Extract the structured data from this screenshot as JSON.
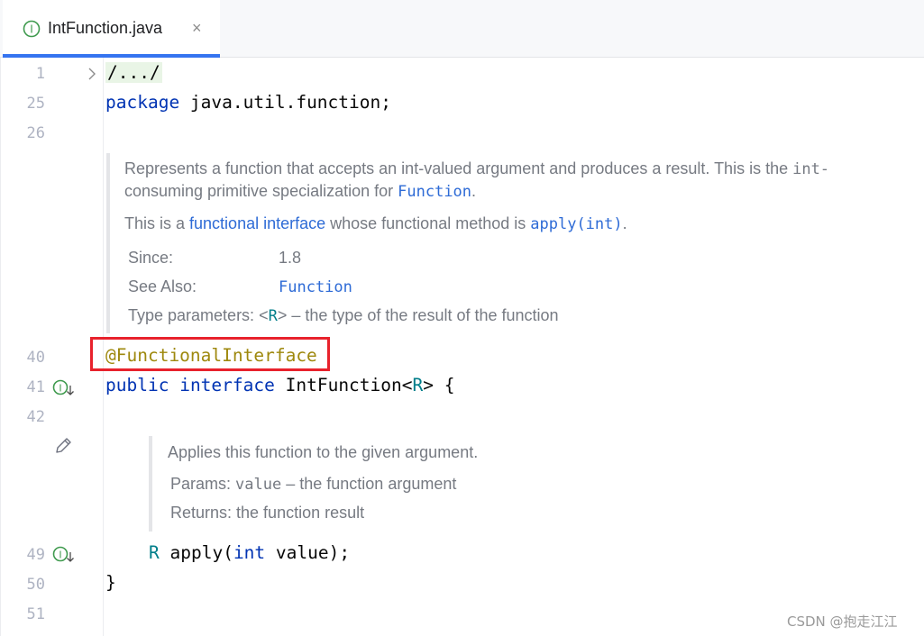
{
  "tab": {
    "filename": "IntFunction.java",
    "close_glyph": "×"
  },
  "lines": {
    "l1": "1",
    "l25": "25",
    "l26": "26",
    "l40": "40",
    "l41": "41",
    "l42": "42",
    "l49": "49",
    "l50": "50",
    "l51": "51"
  },
  "code": {
    "fold_placeholder": "/.../",
    "package_kw": "package",
    "package_name": " java.util.function;",
    "annotation": "@FunctionalInterface",
    "public_kw": "public",
    "interface_kw": "interface",
    "class_name": " IntFunction<",
    "type_param": "R",
    "class_tail": "> {",
    "ret_type": "R",
    "method_name": " apply(",
    "int_kw": "int",
    "method_tail": " value);",
    "close_brace": "}"
  },
  "doc1": {
    "line1_text": "Represents a function that accepts an int-valued argument and produces a result. This is the ",
    "line1_code": "int-",
    "line2_text": "consuming primitive specialization for ",
    "line2_link": "Function",
    "line2_end": ".",
    "line3_pre": "This is a ",
    "line3_link": "functional interface",
    "line3_mid": " whose functional method is ",
    "line3_code": "apply(int)",
    "line3_end": ".",
    "since_label": "Since:",
    "since_value": "1.8",
    "see_label": "See Also:",
    "see_value": "Function",
    "type_label": "Type parameters:",
    "type_lt": " <",
    "type_param": "R",
    "type_rest": "> – the type of the result of the function"
  },
  "doc2": {
    "summary": "Applies this function to the given argument.",
    "params_label": "Params:",
    "params_code": "value",
    "params_rest": " – the function argument",
    "returns_label": "Returns:",
    "returns_rest": " the function result"
  },
  "gutter_icons": [
    "implemented-interface-icon",
    "implemented-method-icon",
    "edit-doc-icon",
    "fold-chevron-icon"
  ],
  "watermark": "CSDN @抱走江江",
  "colors": {
    "tab_accent": "#3574f0",
    "highlight_box": "#e8222c",
    "keyword": "#0033b3",
    "annotation": "#9e880d",
    "link": "#2e6bd6"
  }
}
